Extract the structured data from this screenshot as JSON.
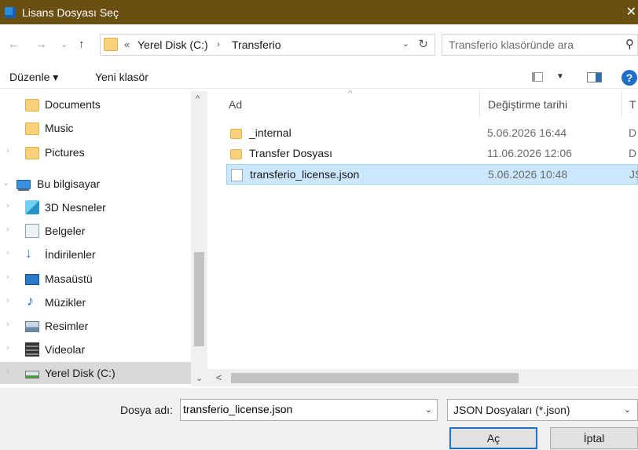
{
  "window": {
    "title": "Lisans Dosyası Seç",
    "close_glyph": "✕"
  },
  "address": {
    "back_glyph": "←",
    "forward_glyph": "→",
    "recent_glyph": "⌄",
    "up_glyph": "↑",
    "more_glyph": "«",
    "crumbs": [
      "Yerel Disk (C:)",
      "Transferio"
    ],
    "sep_glyph": "›",
    "dropdown_glyph": "⌄",
    "refresh_glyph": "↻"
  },
  "search": {
    "placeholder": "Transferio klasöründe ara",
    "icon_glyph": "⚲"
  },
  "toolbar": {
    "organize_label": "Düzenle ▾",
    "new_folder_label": "Yeni klasör",
    "view_dd": "▼",
    "help": "?"
  },
  "navpane": {
    "items": [
      {
        "label": "Documents",
        "icon": "folder-icon"
      },
      {
        "label": "Music",
        "icon": "folder-icon"
      },
      {
        "label": "Pictures",
        "icon": "folder-icon"
      },
      {
        "label": "Bu bilgisayar",
        "icon": "computer-icon"
      },
      {
        "label": "3D Nesneler",
        "icon": "cube-icon"
      },
      {
        "label": "Belgeler",
        "icon": "documents-icon"
      },
      {
        "label": "İndirilenler",
        "icon": "download-icon"
      },
      {
        "label": "Masaüstü",
        "icon": "desktop-icon"
      },
      {
        "label": "Müzikler",
        "icon": "music-icon"
      },
      {
        "label": "Resimler",
        "icon": "pictures-icon"
      },
      {
        "label": "Videolar",
        "icon": "video-icon"
      },
      {
        "label": "Yerel Disk (C:)",
        "icon": "disk-icon"
      }
    ],
    "chev_right": "›",
    "chev_down": "⌄",
    "scroll_up": "^",
    "scroll_down": "⌄"
  },
  "filelist": {
    "columns": {
      "name": "Ad",
      "date": "Değiştirme tarihi",
      "type": "T"
    },
    "sort_glyph": "^",
    "rows": [
      {
        "name": "_internal",
        "date": "5.06.2026 16:44",
        "type": "D",
        "kind": "folder"
      },
      {
        "name": "Transfer Dosyası",
        "date": "11.06.2026 12:06",
        "type": "D",
        "kind": "folder"
      },
      {
        "name": "transferio_license.json",
        "date": "5.06.2026 10:48",
        "type": "JS",
        "kind": "file"
      }
    ],
    "hscroll_left": "<"
  },
  "bottom": {
    "filename_label": "Dosya adı:",
    "filename_value": "transferio_license.json",
    "dd_glyph": "⌄",
    "filetype_value": "JSON Dosyaları (*.json)",
    "open_label": "Aç",
    "cancel_label": "İptal"
  }
}
